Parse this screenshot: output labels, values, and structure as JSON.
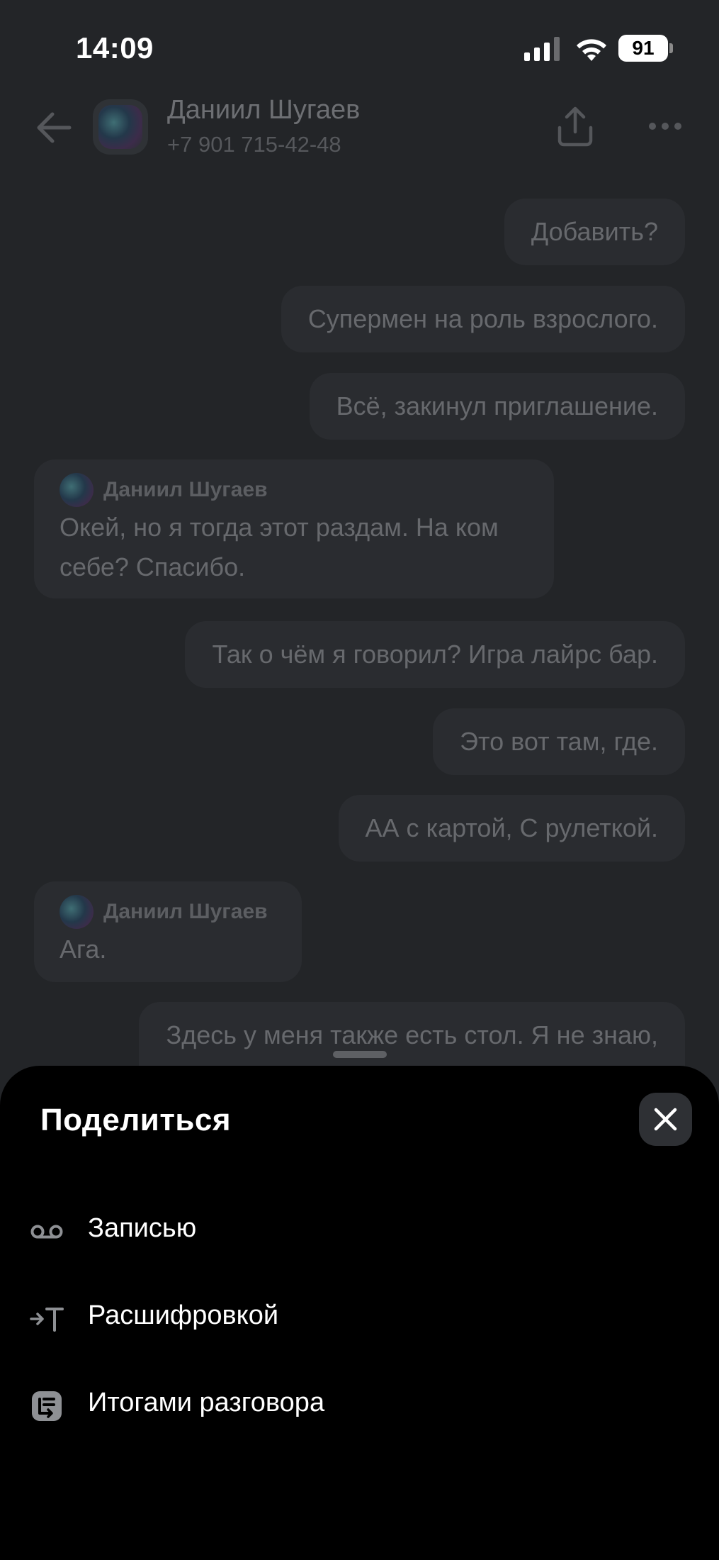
{
  "status_bar": {
    "time": "14:09",
    "battery": "91"
  },
  "header": {
    "contact_name": "Даниил Шугаев",
    "contact_phone": "+7 901 715-42-48",
    "icons": [
      "back-arrow-icon",
      "avatar",
      "share-icon",
      "more-icon"
    ]
  },
  "messages": [
    {
      "direction": "out",
      "text": "Добавить?"
    },
    {
      "direction": "out",
      "text": "Супермен на роль взрослого."
    },
    {
      "direction": "out",
      "text": "Всё, закинул приглашение."
    },
    {
      "direction": "in",
      "sender": "Даниил Шугаев",
      "text_line1": "Окей, но я тогда этот раздам. На ком",
      "text_line2": "себе? Спасибо."
    },
    {
      "direction": "out",
      "text": "Так о чём я говорил? Игра лайрс бар."
    },
    {
      "direction": "out",
      "text": "Это вот там, где."
    },
    {
      "direction": "out",
      "text": "АА с картой, С рулеткой."
    },
    {
      "direction": "in",
      "sender": "Даниил Шугаев",
      "text": "Ага."
    },
    {
      "direction": "out",
      "text": "Здесь у меня также есть стол. Я не знаю,"
    }
  ],
  "share_sheet": {
    "title": "Поделиться",
    "items": [
      {
        "label": "Записью",
        "icon": "voicemail-icon"
      },
      {
        "label": "Расшифровкой",
        "icon": "transcript-icon"
      },
      {
        "label": "Итогами разговора",
        "icon": "summary-icon"
      }
    ]
  },
  "colors": {
    "background": "#232528",
    "bubble": "#2a2c30",
    "sheet": "#000000",
    "close_button": "#2e3034"
  }
}
